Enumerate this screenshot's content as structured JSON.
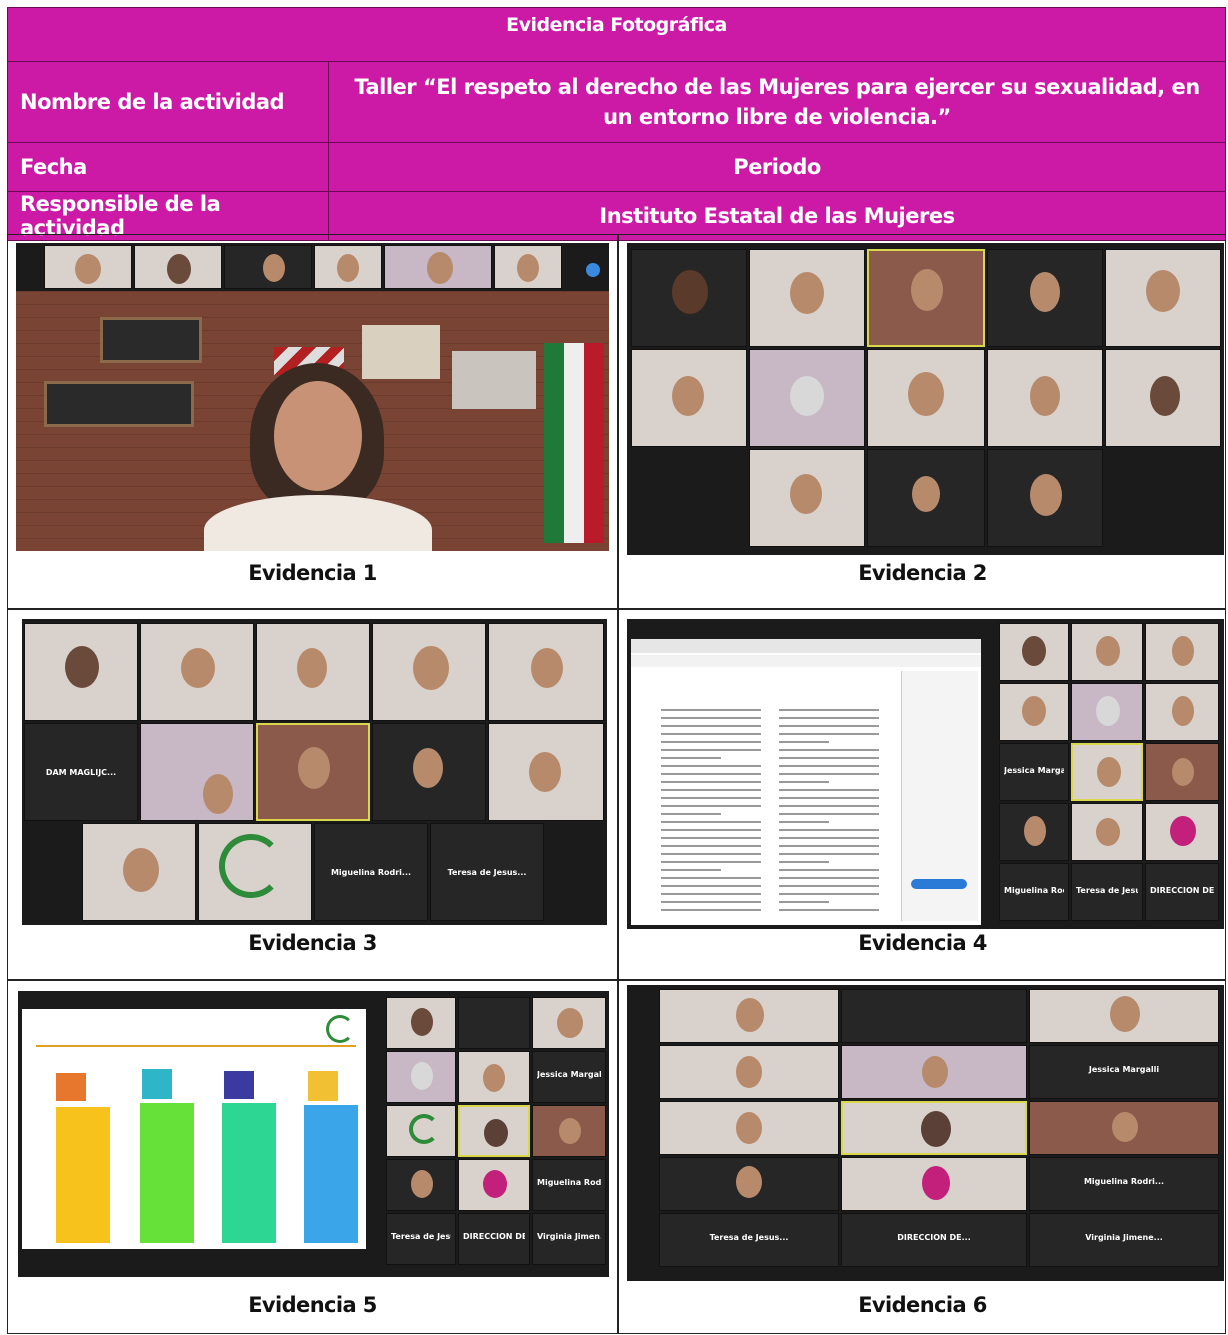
{
  "header": {
    "title": "Evidencia Fotográfica",
    "rows": [
      {
        "label": "Nombre de la actividad",
        "value": "Taller “El respeto al derecho de las Mujeres para ejercer su sexualidad, en un entorno libre de violencia.”"
      },
      {
        "label": "Fecha",
        "value": "Periodo"
      },
      {
        "label": "Responsible de la actividad",
        "value": "Instituto Estatal de las Mujeres"
      }
    ]
  },
  "captions": [
    "Evidencia 1",
    "Evidencia 2",
    "Evidencia 3",
    "Evidencia 4",
    "Evidencia 5",
    "Evidencia 6"
  ],
  "participants": {
    "e3": [
      "DAM MAGLIJC...",
      "Miguelina Rodri...",
      "Teresa de Jesus..."
    ],
    "e4": [
      "Jessica Margalli",
      "Miguelina Rodri...",
      "Teresa de Jesus...",
      "DIRECCION DE..."
    ],
    "e5": [
      "Jessica Margalli",
      "Miguelina Rodri...",
      "Teresa de Jesus...",
      "DIRECCION DE...",
      "Virginia Jimen..."
    ],
    "e6": [
      "Jessica Margalli",
      "Miguelina Rodri...",
      "Teresa de Jesus...",
      "DIRECCION DE...",
      "Virginia Jimene..."
    ]
  },
  "colors": {
    "header_bg": "#cc1aa6",
    "header_text": "#ffffff",
    "zoom_bg": "#1b1b1b",
    "active_speaker": "#d8d84a"
  }
}
